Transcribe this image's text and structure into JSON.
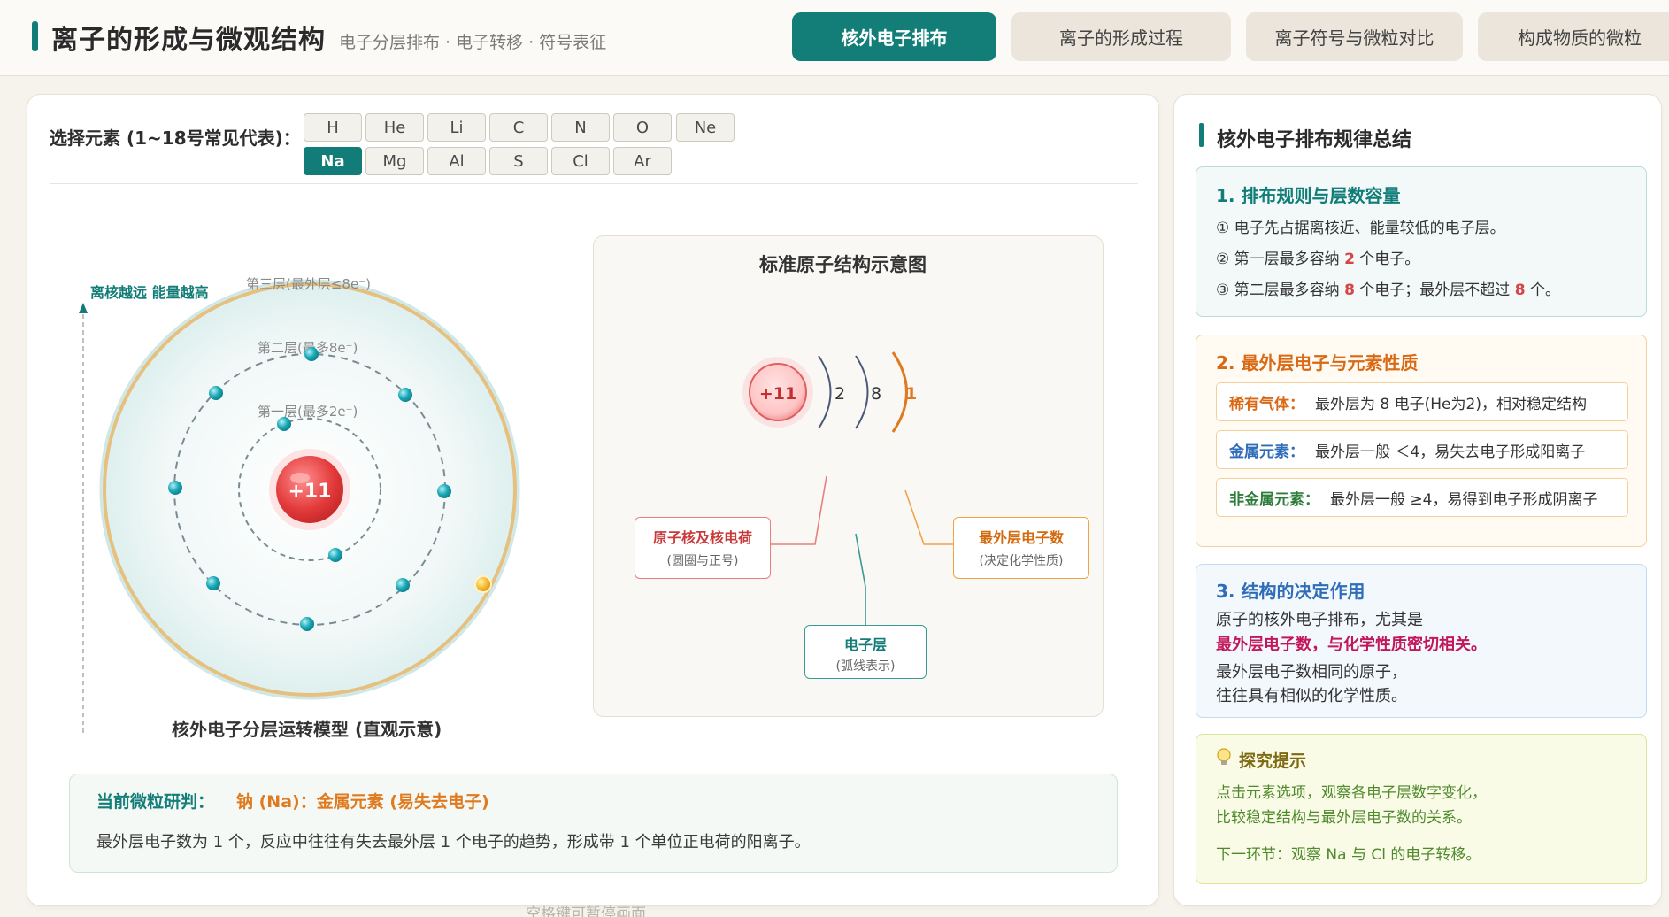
{
  "header": {
    "title": "离子的形成与微观结构",
    "subtitle": "电子分层排布 · 电子转移 · 符号表征",
    "tabs": [
      {
        "label": "核外电子排布",
        "active": true
      },
      {
        "label": "离子的形成过程",
        "active": false
      },
      {
        "label": "离子符号与微粒对比",
        "active": false
      },
      {
        "label": "构成物质的微粒",
        "active": false
      }
    ]
  },
  "picker": {
    "label": "选择元素 (1~18号常见代表)：",
    "elements": [
      "H",
      "He",
      "Li",
      "C",
      "N",
      "O",
      "Ne",
      "Na",
      "Mg",
      "Al",
      "S",
      "Cl",
      "Ar"
    ],
    "selected": "Na"
  },
  "model": {
    "axis_label": "离核越远 能量越高",
    "shell_labels": [
      "第三层(最外层≤8e⁻)",
      "第二层(最多8e⁻)",
      "第一层(最多2e⁻)"
    ],
    "nucleus_charge": "+11",
    "electrons_per_shell": [
      2,
      8,
      1
    ],
    "caption": "核外电子分层运转模型 (直观示意)"
  },
  "structure": {
    "title": "标准原子结构示意图",
    "nucleus": "+11",
    "shells": [
      "2",
      "8",
      "1"
    ],
    "callouts": [
      {
        "title": "原子核及核电荷",
        "sub": "(圆圈与正号)"
      },
      {
        "title": "电子层",
        "sub": "(弧线表示)"
      },
      {
        "title": "最外层电子数",
        "sub": "(决定化学性质)"
      }
    ]
  },
  "verdict": {
    "label": "当前微粒研判：",
    "value": "钠 (Na)：金属元素 (易失去电子)",
    "description": "最外层电子数为 1 个，反应中往往有失去最外层 1 个电子的趋势，形成带 1 个单位正电荷的阳离子。"
  },
  "footer_hint": "空格键可暂停画面",
  "summary": {
    "title": "核外电子排布规律总结",
    "card1": {
      "title": "1. 排布规则与层数容量",
      "r1": "① 电子先占据离核近、能量较低的电子层。",
      "r2_a": "② 第一层最多容纳 ",
      "r2_num": "2",
      "r2_b": " 个电子。",
      "r3_a": "③ 第二层最多容纳 ",
      "r3_num1": "8",
      "r3_b": " 个电子；最外层不超过 ",
      "r3_num2": "8",
      "r3_c": " 个。"
    },
    "card2": {
      "title": "2. 最外层电子与元素性质",
      "rows": [
        {
          "name": "稀有气体：",
          "text": "最外层为 8 电子(He为2)，相对稳定结构"
        },
        {
          "name": "金属元素：",
          "text": "最外层一般 ＜4，易失去电子形成阳离子"
        },
        {
          "name": "非金属元素：",
          "text": "最外层一般 ≥4，易得到电子形成阴离子"
        }
      ]
    },
    "card3": {
      "title": "3. 结构的决定作用",
      "l1": "原子的核外电子排布，尤其是",
      "l2": "最外层电子数，与化学性质密切相关。",
      "l3": "最外层电子数相同的原子，",
      "l4": "往往具有相似的化学性质。"
    },
    "card4": {
      "title": "探究提示",
      "l1": "点击元素选项，观察各电子层数字变化，",
      "l2": "比较稳定结构与最外层电子数的关系。",
      "l3": "下一环节：观察 Na 与 Cl 的电子转移。"
    }
  },
  "colors": {
    "accent": "#127d78",
    "orange": "#e07a1f",
    "red": "#d64545",
    "blue": "#2f6db8",
    "green": "#2e7d3a"
  }
}
